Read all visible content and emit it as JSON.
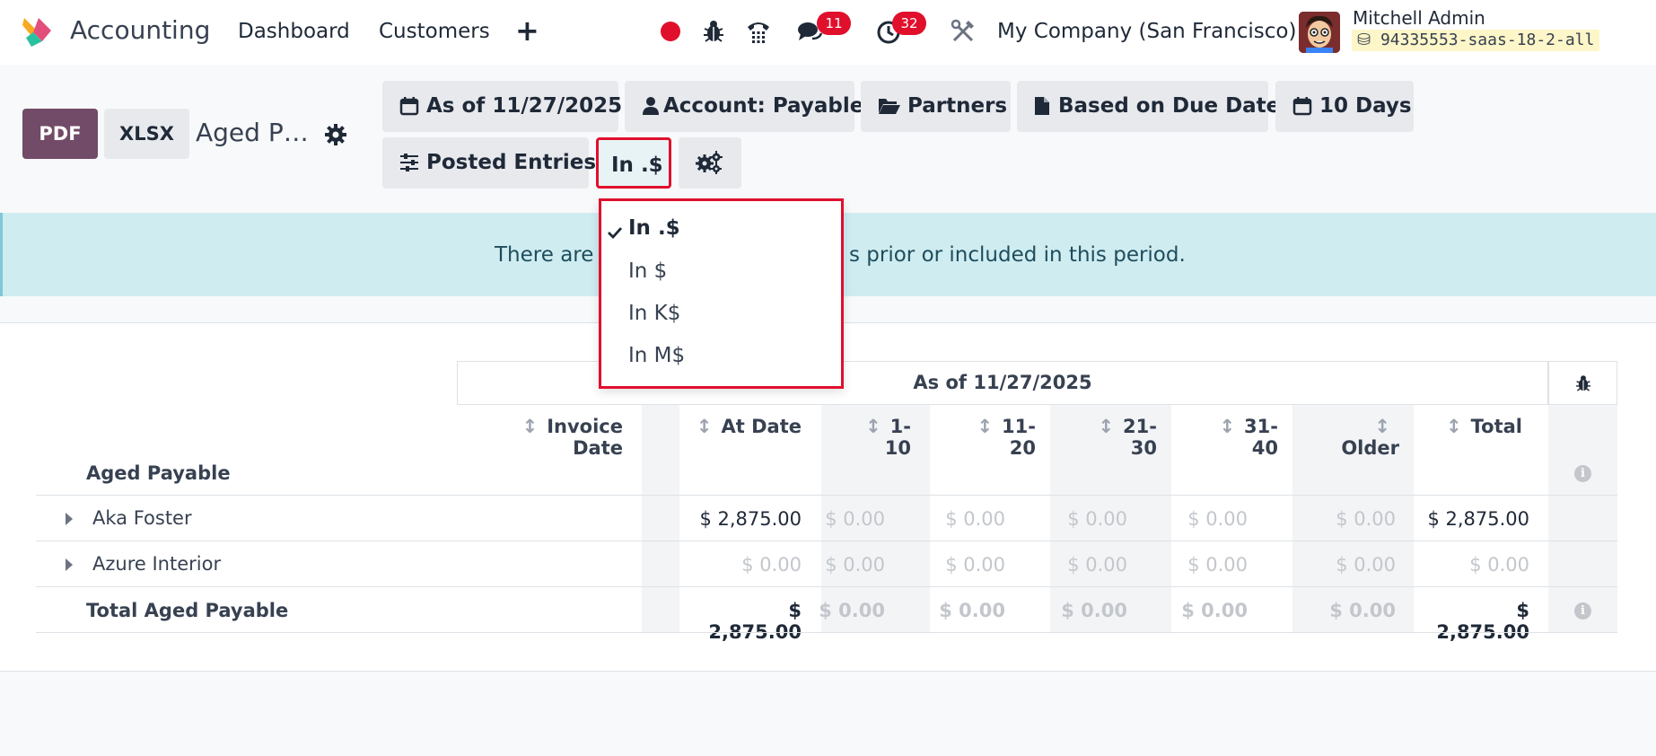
{
  "navbar": {
    "app_title": "Accounting",
    "links": [
      "Dashboard",
      "Customers"
    ],
    "plus": "+",
    "messages_count": "11",
    "activities_count": "32",
    "company": "My Company (San Francisco)",
    "user_name": "Mitchell Admin",
    "database": "94335553-saas-18-2-all"
  },
  "toolbar": {
    "pdf_label": "PDF",
    "xlsx_label": "XLSX",
    "report_title": "Aged P…"
  },
  "filters": {
    "as_of": "As of 11/27/2025",
    "account": "Account: Payable",
    "partners": "Partners",
    "based_on": "Based on Due Date",
    "period": "10 Days",
    "posted": "Posted Entries",
    "rounding": "In .$"
  },
  "rounding_menu": {
    "options": [
      "In .$",
      "In $",
      "In K$",
      "In M$"
    ],
    "selected": "In .$"
  },
  "alert": {
    "text_left": "There are",
    "text_right": "s prior or included in this period."
  },
  "report": {
    "period_header": "As of 11/27/2025",
    "columns": [
      "Invoice Date",
      "At Date",
      "1-10",
      "11-20",
      "21-30",
      "31-40",
      "Older",
      "Total"
    ],
    "section": "Aged Payable",
    "rows": [
      {
        "name": "Aka Foster",
        "values": [
          "$ 2,875.00",
          "$ 0.00",
          "$ 0.00",
          "$ 0.00",
          "$ 0.00",
          "$ 0.00",
          "$ 2,875.00"
        ]
      },
      {
        "name": "Azure Interior",
        "values": [
          "$ 0.00",
          "$ 0.00",
          "$ 0.00",
          "$ 0.00",
          "$ 0.00",
          "$ 0.00",
          "$ 0.00"
        ]
      }
    ],
    "total": {
      "name": "Total Aged Payable",
      "values": [
        "$ 2,875.00",
        "$ 0.00",
        "$ 0.00",
        "$ 0.00",
        "$ 0.00",
        "$ 0.00",
        "$ 2,875.00"
      ]
    }
  },
  "colors": {
    "brand": "#714b67",
    "badge": "#e0102d",
    "highlight": "#e0102d",
    "alert_bg": "#cfecf1"
  }
}
